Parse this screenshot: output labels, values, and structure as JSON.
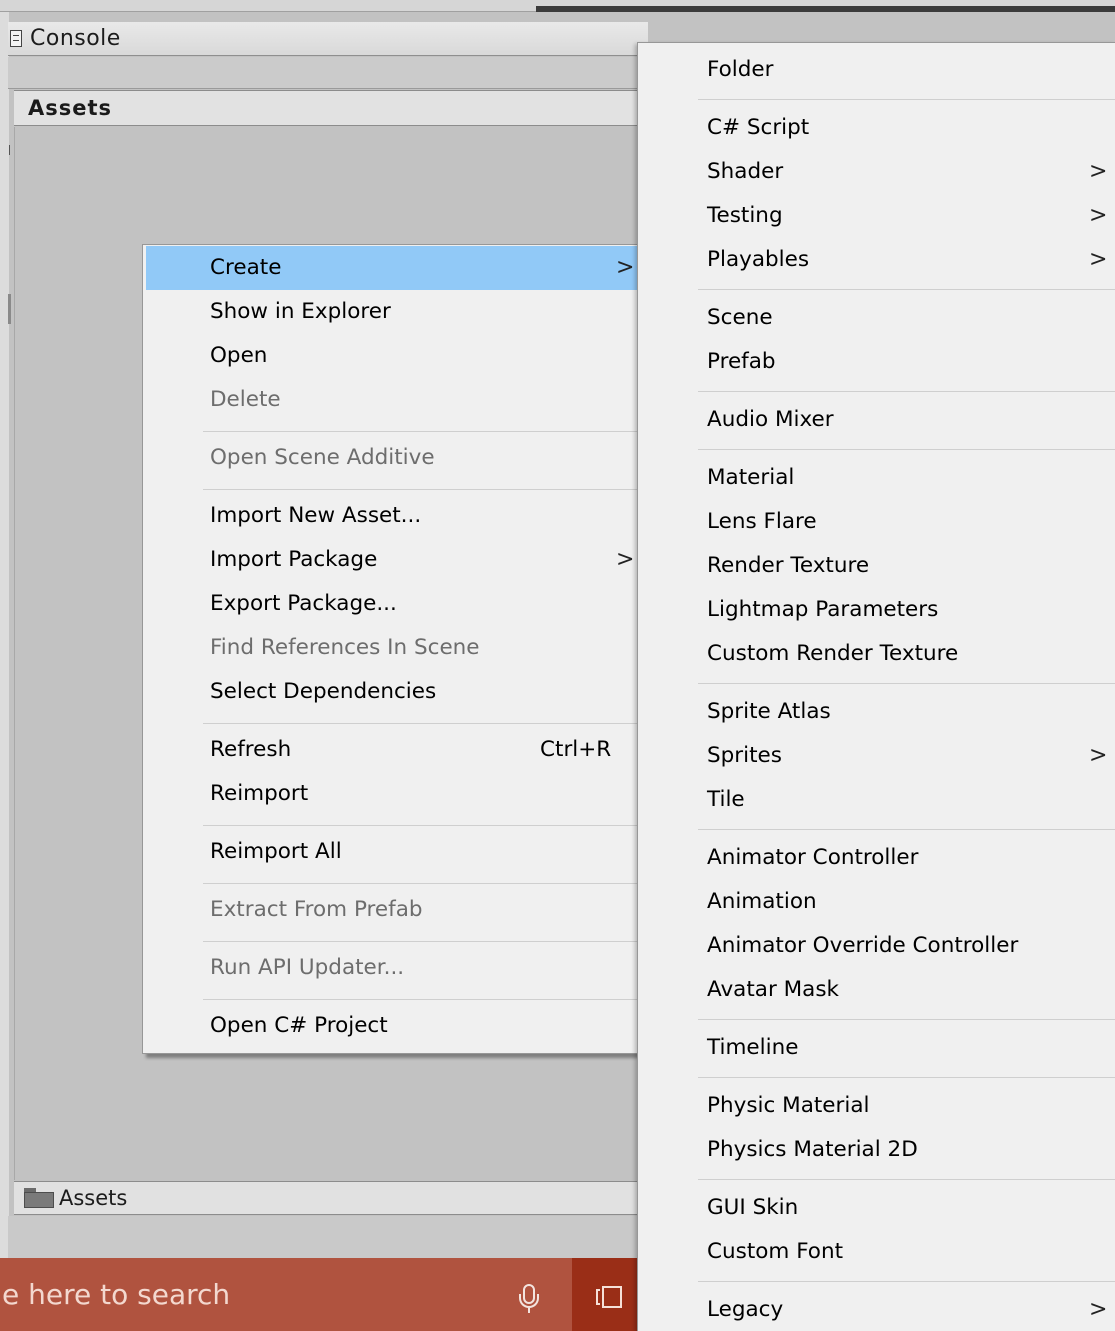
{
  "console_tab": {
    "label": "Console"
  },
  "project_panel": {
    "title": "Assets",
    "breadcrumb": "Assets"
  },
  "taskbar": {
    "search_placeholder": "e here to search"
  },
  "context_menu": {
    "items": [
      {
        "label": "Create",
        "has_submenu": true,
        "highlighted": true
      },
      {
        "label": "Show in Explorer"
      },
      {
        "label": "Open"
      },
      {
        "label": "Delete",
        "disabled": true
      },
      {
        "label": "Open Scene Additive",
        "disabled": true
      },
      {
        "label": "Import New Asset..."
      },
      {
        "label": "Import Package",
        "has_submenu": true
      },
      {
        "label": "Export Package..."
      },
      {
        "label": "Find References In Scene",
        "disabled": true
      },
      {
        "label": "Select Dependencies"
      },
      {
        "label": "Refresh",
        "shortcut": "Ctrl+R"
      },
      {
        "label": "Reimport"
      },
      {
        "label": "Reimport All"
      },
      {
        "label": "Extract From Prefab",
        "disabled": true
      },
      {
        "label": "Run API Updater...",
        "disabled": true
      },
      {
        "label": "Open C# Project"
      }
    ]
  },
  "create_menu": {
    "items": [
      {
        "label": "Folder"
      },
      {
        "label": "C# Script"
      },
      {
        "label": "Shader",
        "has_submenu": true
      },
      {
        "label": "Testing",
        "has_submenu": true
      },
      {
        "label": "Playables",
        "has_submenu": true
      },
      {
        "label": "Scene"
      },
      {
        "label": "Prefab"
      },
      {
        "label": "Audio Mixer"
      },
      {
        "label": "Material"
      },
      {
        "label": "Lens Flare"
      },
      {
        "label": "Render Texture"
      },
      {
        "label": "Lightmap Parameters"
      },
      {
        "label": "Custom Render Texture"
      },
      {
        "label": "Sprite Atlas"
      },
      {
        "label": "Sprites",
        "has_submenu": true
      },
      {
        "label": "Tile"
      },
      {
        "label": "Animator Controller"
      },
      {
        "label": "Animation"
      },
      {
        "label": "Animator Override Controller"
      },
      {
        "label": "Avatar Mask"
      },
      {
        "label": "Timeline"
      },
      {
        "label": "Physic Material"
      },
      {
        "label": "Physics Material 2D"
      },
      {
        "label": "GUI Skin"
      },
      {
        "label": "Custom Font"
      },
      {
        "label": "Legacy",
        "has_submenu": true
      }
    ]
  },
  "glyphs": {
    "submenu_arrow": ">"
  },
  "colors": {
    "menu_highlight": "#91c9f7",
    "taskbar_search": "#b0533f",
    "taskbar_button": "#9a2e17"
  }
}
